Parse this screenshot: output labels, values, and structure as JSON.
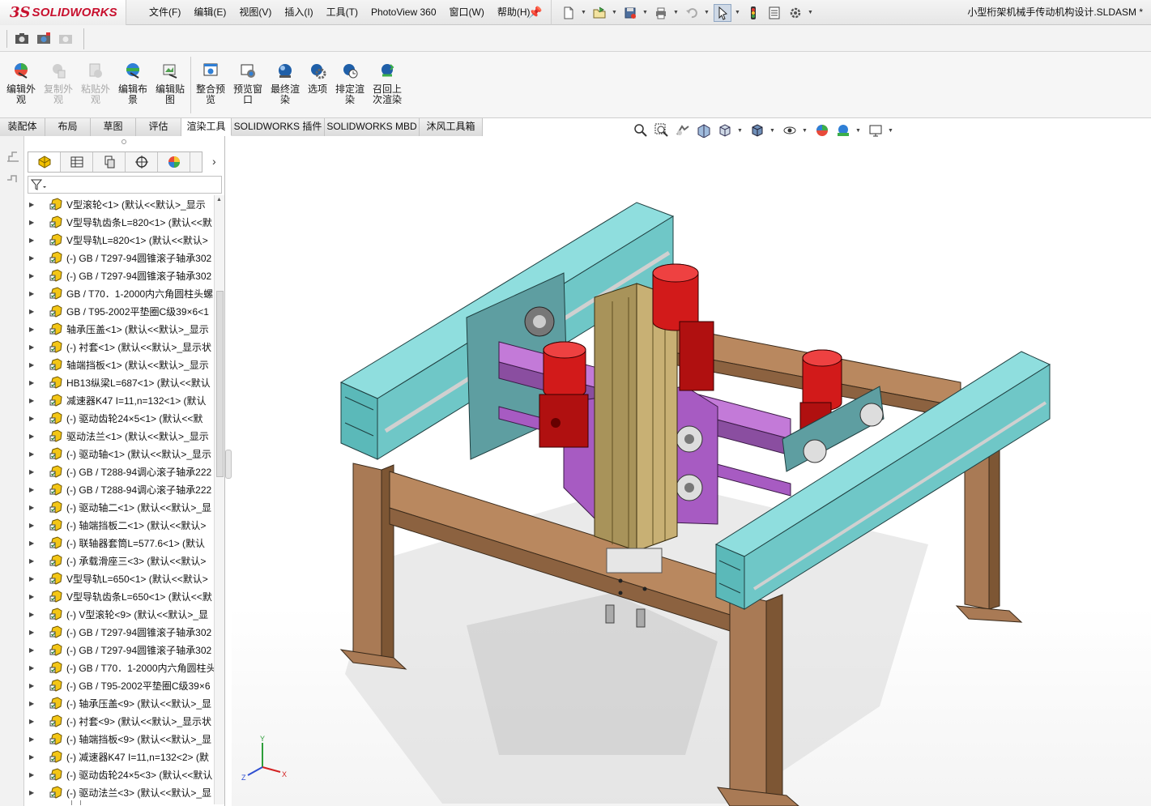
{
  "app": {
    "logo_prefix": "3S",
    "logo_text": "SOLIDWORKS",
    "document_title": "小型桁架机械手传动机构设计.SLDASM *"
  },
  "menu": {
    "items": [
      "文件(F)",
      "编辑(E)",
      "视图(V)",
      "插入(I)",
      "工具(T)",
      "PhotoView 360",
      "窗口(W)",
      "帮助(H)"
    ]
  },
  "quick_access": {
    "icons": [
      "new-icon",
      "open-icon",
      "save-icon",
      "print-icon",
      "undo-icon",
      "select-icon",
      "traffic-light-icon",
      "file-properties-icon",
      "options-icon"
    ]
  },
  "ribbon": {
    "buttons": [
      {
        "label": "编辑外观",
        "icon": "edit-appearance-icon",
        "enabled": true
      },
      {
        "label": "复制外观",
        "icon": "copy-appearance-icon",
        "enabled": false
      },
      {
        "label": "粘贴外观",
        "icon": "paste-appearance-icon",
        "enabled": false
      },
      {
        "label": "编辑布景",
        "icon": "edit-scene-icon",
        "enabled": true
      },
      {
        "label": "编辑贴图",
        "icon": "edit-decal-icon",
        "enabled": true
      },
      {
        "label": "整合预览",
        "icon": "integrated-preview-icon",
        "enabled": true
      },
      {
        "label": "预览窗口",
        "icon": "preview-window-icon",
        "enabled": true
      },
      {
        "label": "最终渲染",
        "icon": "final-render-icon",
        "enabled": true
      },
      {
        "label": "选项",
        "icon": "render-options-icon",
        "enabled": true
      },
      {
        "label": "排定渲染",
        "icon": "schedule-render-icon",
        "enabled": true
      },
      {
        "label": "召回上次渲染",
        "icon": "recall-last-render-icon",
        "enabled": true
      }
    ]
  },
  "tabs": [
    {
      "label": "装配体",
      "active": false
    },
    {
      "label": "布局",
      "active": false
    },
    {
      "label": "草图",
      "active": false
    },
    {
      "label": "评估",
      "active": false
    },
    {
      "label": "渲染工具",
      "active": true
    },
    {
      "label": "SOLIDWORKS 插件",
      "active": false
    },
    {
      "label": "SOLIDWORKS MBD",
      "active": false
    },
    {
      "label": "沐风工具箱",
      "active": false
    }
  ],
  "feature_tree": {
    "items": [
      "V型滚轮<1> (默认<<默认>_显示",
      "V型导轨齿条L=820<1> (默认<<默",
      "V型导轨L=820<1> (默认<<默认>",
      "(-) GB / T297-94圆锥滚子轴承302",
      "(-) GB / T297-94圆锥滚子轴承302",
      "GB / T70．1-2000内六角圆柱头螺",
      "GB / T95-2002平垫圈C级39×6<1",
      "轴承压盖<1> (默认<<默认>_显示",
      "(-) 衬套<1> (默认<<默认>_显示状",
      "轴端挡板<1> (默认<<默认>_显示",
      "HB13纵梁L=687<1> (默认<<默认",
      "减速器K47 I=11,n=132<1> (默认",
      "(-) 驱动齿轮24×5<1> (默认<<默",
      "驱动法兰<1> (默认<<默认>_显示",
      "(-) 驱动轴<1> (默认<<默认>_显示",
      "(-) GB / T288-94调心滚子轴承222",
      "(-) GB / T288-94调心滚子轴承222",
      "(-) 驱动轴二<1> (默认<<默认>_显",
      "(-) 轴端挡板二<1> (默认<<默认>",
      "(-) 联轴器套筒L=577.6<1> (默认",
      "(-) 承载滑座三<3> (默认<<默认>",
      "V型导轨L=650<1> (默认<<默认>",
      "V型导轨齿条L=650<1> (默认<<默",
      "(-) V型滚轮<9> (默认<<默认>_显",
      "(-) GB / T297-94圆锥滚子轴承302",
      "(-) GB / T297-94圆锥滚子轴承302",
      "(-) GB / T70．1-2000内六角圆柱头",
      "(-) GB / T95-2002平垫圈C级39×6",
      "(-) 轴承压盖<9> (默认<<默认>_显",
      "(-) 衬套<9> (默认<<默认>_显示状",
      "(-) 轴端挡板<9> (默认<<默认>_显",
      "(-) 减速器K47 I=11,n=132<2> (默",
      "(-) 驱动齿轮24×5<3> (默认<<默认",
      "(-) 驱动法兰<3> (默认<<默认>_显"
    ]
  },
  "triad": {
    "x": "X",
    "y": "Y",
    "z": "Z"
  },
  "colors": {
    "brand": "#c8102e",
    "rail": "#6fc7c7",
    "frame": "#a97a55",
    "motor": "#d21a1a",
    "slide": "#a75bc2",
    "column": "#a8935a"
  }
}
